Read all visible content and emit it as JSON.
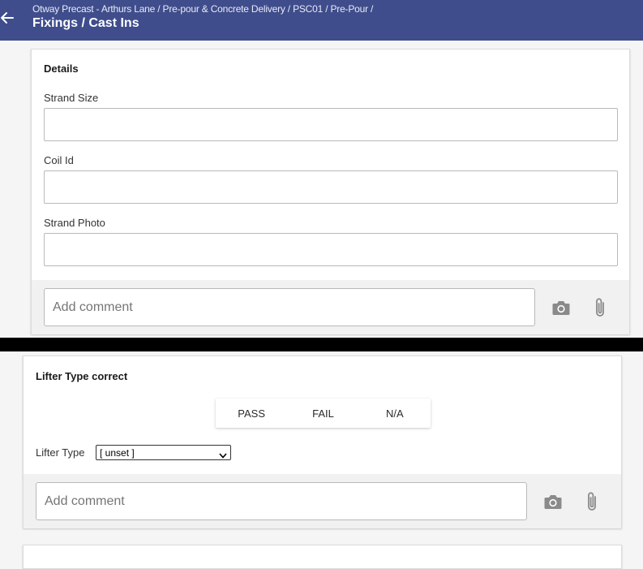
{
  "header": {
    "breadcrumb": "Otway Precast - Arthurs Lane / Pre-pour & Concrete Delivery / PSC01 / Pre-Pour /",
    "title": "Fixings / Cast Ins",
    "back_icon": "arrow-left-icon",
    "background": "#3f4d8c"
  },
  "details_card": {
    "title": "Details",
    "fields": [
      {
        "label": "Strand Size",
        "value": ""
      },
      {
        "label": "Coil Id",
        "value": ""
      },
      {
        "label": "Strand Photo",
        "value": ""
      }
    ],
    "comment_placeholder": "Add comment",
    "camera_icon": "camera-icon",
    "attach_icon": "paperclip-icon"
  },
  "lifter_card": {
    "title": "Lifter Type correct",
    "options": [
      "PASS",
      "FAIL",
      "N/A"
    ],
    "select_label": "Lifter Type",
    "select_value": "[ unset ]",
    "comment_placeholder": "Add comment",
    "camera_icon": "camera-icon",
    "attach_icon": "paperclip-icon"
  }
}
